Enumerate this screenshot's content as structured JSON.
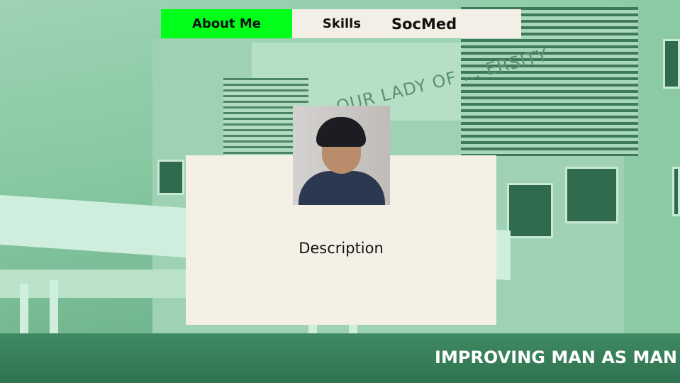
{
  "nav": {
    "tabs": [
      {
        "label": "About Me",
        "active": true
      },
      {
        "label": "Skills",
        "active": false
      },
      {
        "label": "SocMed",
        "active": false
      }
    ],
    "active_color": "#00ff19"
  },
  "profile": {
    "description": "Description"
  },
  "background": {
    "sign_text": "OUR LADY OF ... ERSITY",
    "slogan": "IMPROVING MAN AS MAN"
  }
}
